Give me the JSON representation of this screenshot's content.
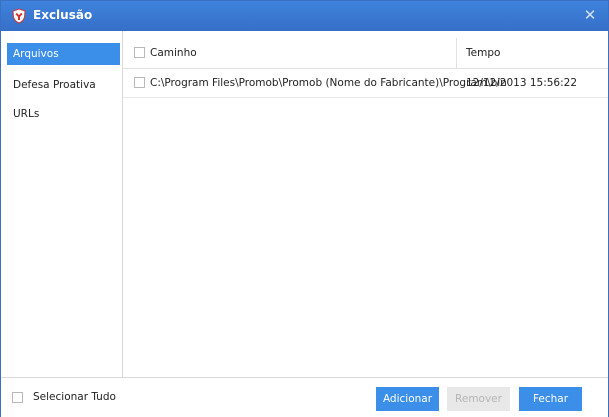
{
  "window": {
    "title": "Exclusão",
    "close_symbol": "✕"
  },
  "sidebar": {
    "items": [
      {
        "label": "Arquivos",
        "active": true
      },
      {
        "label": "Defesa Proativa",
        "active": false
      },
      {
        "label": "URLs",
        "active": false
      }
    ]
  },
  "table": {
    "headers": {
      "path": "Caminho",
      "time": "Tempo"
    },
    "rows": [
      {
        "path": "C:\\Program Files\\Promob\\Promob (Nome do Fabricante)\\Program\\bin",
        "time": "12/12/2013 15:56:22",
        "checked": false
      }
    ]
  },
  "footer": {
    "select_all_label": "Selecionar Tudo",
    "add_label": "Adicionar",
    "remove_label": "Remover",
    "close_label": "Fechar"
  },
  "colors": {
    "titlebar": "#3a7bd5",
    "accent": "#3b8fe8",
    "disabled_button": "#e8e8e8"
  },
  "icons": {
    "title": "shield-icon",
    "close": "close-icon"
  }
}
